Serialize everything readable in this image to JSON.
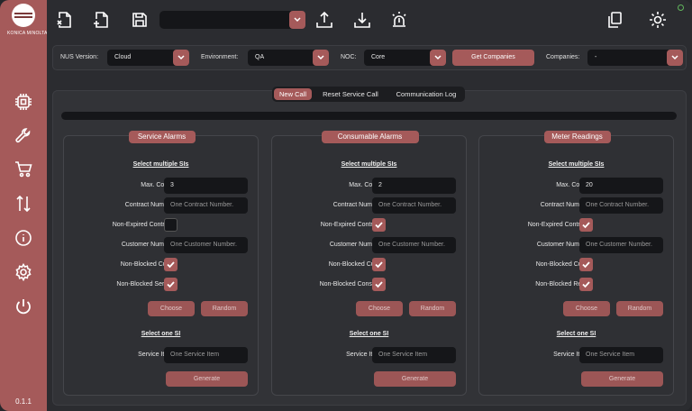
{
  "app": {
    "logo_text": "KONICA MINOLTA",
    "version": "0.1.1",
    "accent": "#a55a5a",
    "status_color": "#61b65c"
  },
  "sidebar": {
    "items": [
      "chip-icon",
      "wrench-icon",
      "cart-icon",
      "sort-icon",
      "info-icon",
      "gear-icon",
      "power-icon"
    ]
  },
  "topbar": {
    "combo_value": "",
    "icons": [
      "close-file-icon",
      "add-file-icon",
      "save-icon",
      "upload-icon",
      "download-icon",
      "alarm-icon",
      "copy-icon",
      "brightness-icon"
    ]
  },
  "config": {
    "nus_label": "NUS Version:",
    "nus_value": "Cloud",
    "env_label": "Environment:",
    "env_value": "QA",
    "noc_label": "NOC:",
    "noc_value": "Core",
    "get_companies": "Get Companies",
    "companies_label": "Companies:",
    "companies_value": "-"
  },
  "tabs": [
    "New Call",
    "Reset Service Call",
    "Communication Log"
  ],
  "progress": 0,
  "panels": [
    {
      "title": "Service Alarms",
      "multi_title": "Select multiple SIs",
      "max_label": "Max. Count:",
      "max_value": "3",
      "contract_label": "Contract Number:",
      "contract_ph": "One Contract Number.",
      "nonexp_label": "Non-Expired Contract:",
      "nonexp": false,
      "customer_label": "Customer Number:",
      "customer_ph": "One Customer Number.",
      "nbcust_label": "Non-Blocked Cust.:",
      "nbcust": true,
      "nb2_label": "Non-Blocked Ser. A.:",
      "nb2": true,
      "choose": "Choose",
      "random": "Random",
      "single_title": "Select one SI",
      "si_label": "Service Item:",
      "si_ph": "One Service Item",
      "generate": "Generate"
    },
    {
      "title": "Consumable Alarms",
      "multi_title": "Select multiple SIs",
      "max_label": "Max. Count:",
      "max_value": "2",
      "contract_label": "Contract Number:",
      "contract_ph": "One Contract Number.",
      "nonexp_label": "Non-Expired Contract:",
      "nonexp": true,
      "customer_label": "Customer Number:",
      "customer_ph": "One Customer Number.",
      "nbcust_label": "Non-Blocked Cust.:",
      "nbcust": true,
      "nb2_label": "Non-Blocked Cons. A.:",
      "nb2": true,
      "choose": "Choose",
      "random": "Random",
      "single_title": "Select one SI",
      "si_label": "Service Item:",
      "si_ph": "One Service Item",
      "generate": "Generate"
    },
    {
      "title": "Meter Readings",
      "multi_title": "Select multiple SIs",
      "max_label": "Max. Count:",
      "max_value": "20",
      "contract_label": "Contract Number:",
      "contract_ph": "One Contract Number.",
      "nonexp_label": "Non-Expired Contract:",
      "nonexp": true,
      "customer_label": "Customer Number:",
      "customer_ph": "One Customer Number.",
      "nbcust_label": "Non-Blocked Cust.:",
      "nbcust": true,
      "nb2_label": "Non-Blocked Read:",
      "nb2": true,
      "choose": "Choose",
      "random": "Random",
      "single_title": "Select one SI",
      "si_label": "Service Item:",
      "si_ph": "One Service Item",
      "generate": "Generate"
    }
  ]
}
